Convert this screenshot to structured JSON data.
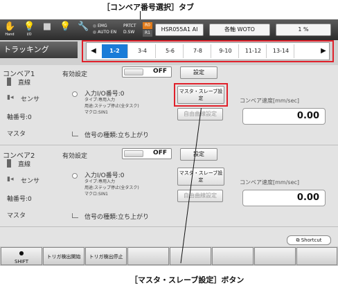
{
  "callouts": {
    "top": "［コンベア番号選択］タブ",
    "bottom": "［マスタ・スレーブ設定］ボタン"
  },
  "statusbar": {
    "icons": [
      {
        "name": "hand-icon",
        "glyph": "✋",
        "caption": "Hand"
      },
      {
        "name": "lamp-icon",
        "glyph": "💡",
        "caption": "I/O"
      },
      {
        "name": "square-icon",
        "glyph": "■",
        "caption": ""
      },
      {
        "name": "bulb-icon",
        "glyph": "💡",
        "caption": ""
      },
      {
        "name": "wrench-icon",
        "glyph": "🔧",
        "caption": ""
      }
    ],
    "emg": "EMG",
    "auto_en": "AUTO EN",
    "protect": "PRTCT",
    "dsw": "D.SW",
    "r0": "R0",
    "r1": "R1",
    "robot_name": "HSR055A1 AI",
    "axis": "各軸 WOTO",
    "speed": "1 %"
  },
  "header": {
    "title": "トラッキング",
    "tabs": [
      "1-2",
      "3-4",
      "5-6",
      "7-8",
      "9-10",
      "11-12",
      "13-14"
    ],
    "active_tab": "1-2"
  },
  "conveyors": [
    {
      "name": "コンベア1",
      "line": "直線",
      "sensor": "センサ",
      "axis_no": "軸番号:0",
      "master": "マスタ",
      "enable_label": "有効設定",
      "enable_value": "OFF",
      "settings_btn": "設定",
      "io_no": "入力I/O番号:0",
      "type": "タイプ:専用入力",
      "usage": "用途:ステップ停止(全タスク)",
      "macro": "マクロ:SIN1",
      "ms_btn": "マスタ・スレーブ設定",
      "free_btn": "自由曲線設定",
      "signal": "信号の種類:立ち上がり",
      "speed_label": "コンベア速度[mm/sec]",
      "speed_value": "0.00"
    },
    {
      "name": "コンベア2",
      "line": "直線",
      "sensor": "センサ",
      "axis_no": "軸番号:0",
      "master": "マスタ",
      "enable_label": "有効設定",
      "enable_value": "OFF",
      "settings_btn": "設定",
      "io_no": "入力I/O番号:0",
      "type": "タイプ:専用入力",
      "usage": "用途:ステップ停止(全タスク)",
      "macro": "マクロ:SIN1",
      "ms_btn": "マスタ・スレーブ設定",
      "free_btn": "自由曲線設定",
      "signal": "信号の種類:立ち上がり",
      "speed_label": "コンベア速度[mm/sec]",
      "speed_value": "0.00"
    }
  ],
  "shortcut": "Shortcut",
  "fkeys": [
    "SHIFT",
    "トリガ検出開始",
    "トリガ検出停止",
    "",
    "",
    "",
    "",
    ""
  ]
}
